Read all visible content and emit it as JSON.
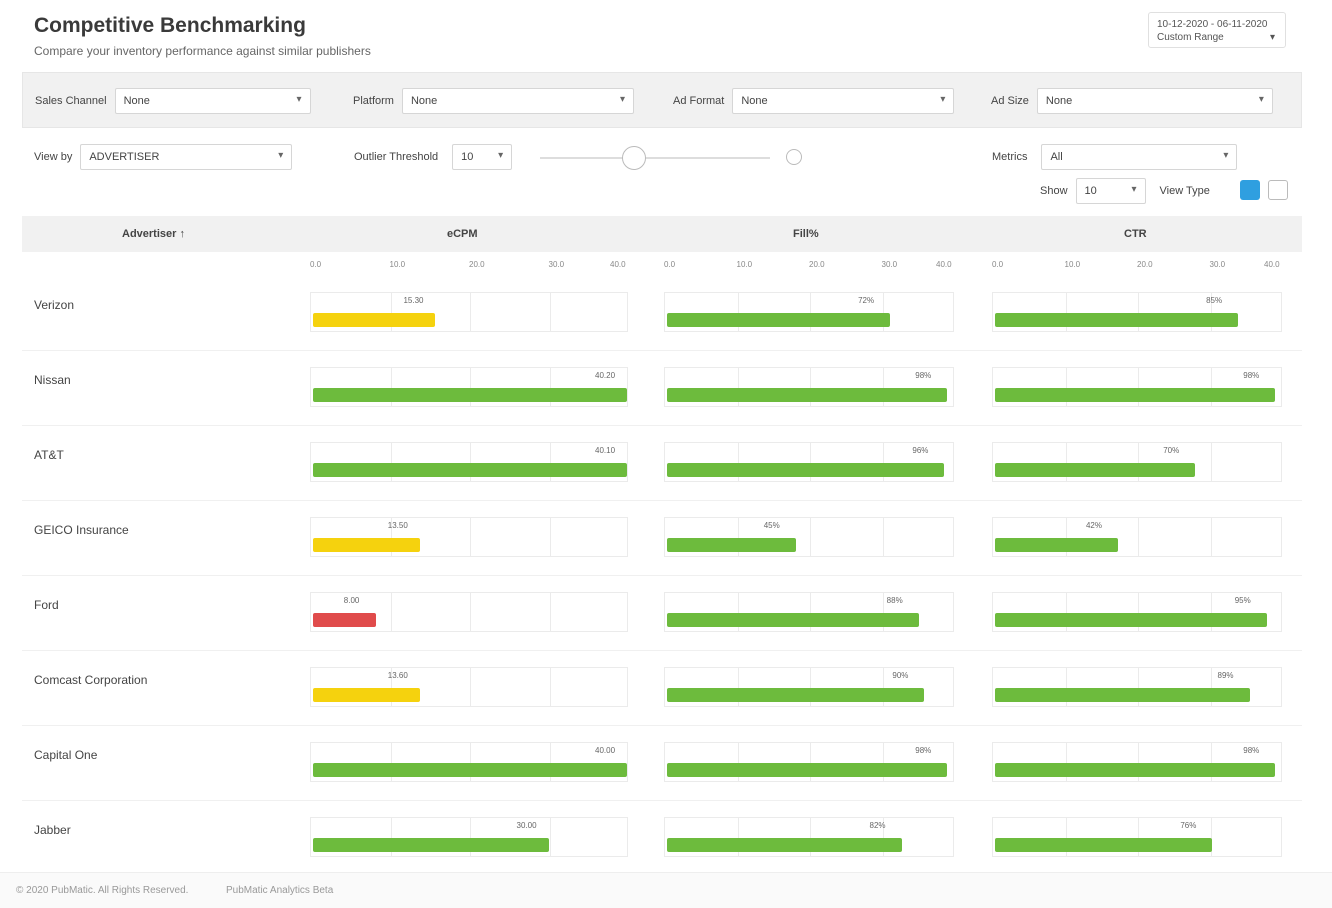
{
  "page": {
    "title": "Competitive Benchmarking",
    "subtitle": "Compare your inventory performance against similar publishers"
  },
  "date_range": {
    "line1": "10-12-2020 - 06-11-2020",
    "line2": "Custom Range",
    "icon": "calendar-icon"
  },
  "filters": [
    {
      "label": "Sales Channel",
      "value": "None"
    },
    {
      "label": "Platform",
      "value": "None"
    },
    {
      "label": "Ad Format",
      "value": "None"
    },
    {
      "label": "Ad Size",
      "value": "None"
    }
  ],
  "controls": {
    "view_by_label": "View by",
    "view_by_value": "ADVERTISER",
    "outlier_label": "Outlier Threshold",
    "outlier_value": "10",
    "metrics_label": "Metrics",
    "metrics_value": "All",
    "show_label": "Show",
    "show_value": "10",
    "view_type_label": "View Type",
    "view_type_active": "bar-view-icon",
    "view_type_inactive": "grid-view-icon"
  },
  "table": {
    "header_advertiser": "Advertiser ↑",
    "columns": [
      "eCPM",
      "Fill%",
      "CTR"
    ],
    "axis_ticks": [
      "0.0",
      "10.0",
      "20.0",
      "30.0",
      "40.0"
    ],
    "rows": [
      {
        "name": "Verizon",
        "values": [
          {
            "value": 15.3,
            "label": "15.30",
            "fraction": 0.39,
            "color": "#f5d20e"
          },
          {
            "value": 72,
            "label": "72%",
            "fraction": 0.78,
            "color": "#6dbb3d"
          },
          {
            "value": 85,
            "label": "85%",
            "fraction": 0.85,
            "color": "#6dbb3d"
          }
        ]
      },
      {
        "name": "Nissan",
        "values": [
          {
            "value": 40.2,
            "label": "40.20",
            "fraction": 1.0,
            "color": "#6dbb3d"
          },
          {
            "value": 98,
            "label": "98%",
            "fraction": 0.98,
            "color": "#6dbb3d"
          },
          {
            "value": 98,
            "label": "98%",
            "fraction": 0.98,
            "color": "#6dbb3d"
          }
        ]
      },
      {
        "name": "AT&T",
        "values": [
          {
            "value": 40.1,
            "label": "40.10",
            "fraction": 1.0,
            "color": "#6dbb3d"
          },
          {
            "value": 96,
            "label": "96%",
            "fraction": 0.97,
            "color": "#6dbb3d"
          },
          {
            "value": 70,
            "label": "70%",
            "fraction": 0.7,
            "color": "#6dbb3d"
          }
        ]
      },
      {
        "name": "GEICO Insurance",
        "values": [
          {
            "value": 13.5,
            "label": "13.50",
            "fraction": 0.34,
            "color": "#f5d20e"
          },
          {
            "value": 45,
            "label": "45%",
            "fraction": 0.45,
            "color": "#6dbb3d"
          },
          {
            "value": 42,
            "label": "42%",
            "fraction": 0.43,
            "color": "#6dbb3d"
          }
        ]
      },
      {
        "name": "Ford",
        "values": [
          {
            "value": 8.0,
            "label": "8.00",
            "fraction": 0.2,
            "color": "#e04b4b"
          },
          {
            "value": 88,
            "label": "88%",
            "fraction": 0.88,
            "color": "#6dbb3d"
          },
          {
            "value": 95,
            "label": "95%",
            "fraction": 0.95,
            "color": "#6dbb3d"
          }
        ]
      },
      {
        "name": "Comcast Corporation",
        "values": [
          {
            "value": 13.6,
            "label": "13.60",
            "fraction": 0.34,
            "color": "#f5d20e"
          },
          {
            "value": 90,
            "label": "90%",
            "fraction": 0.9,
            "color": "#6dbb3d"
          },
          {
            "value": 89,
            "label": "89%",
            "fraction": 0.89,
            "color": "#6dbb3d"
          }
        ]
      },
      {
        "name": "Capital One",
        "values": [
          {
            "value": 40.0,
            "label": "40.00",
            "fraction": 1.0,
            "color": "#6dbb3d"
          },
          {
            "value": 98,
            "label": "98%",
            "fraction": 0.98,
            "color": "#6dbb3d"
          },
          {
            "value": 98,
            "label": "98%",
            "fraction": 0.98,
            "color": "#6dbb3d"
          }
        ]
      },
      {
        "name": "Jabber",
        "values": [
          {
            "value": 30.0,
            "label": "30.00",
            "fraction": 0.75,
            "color": "#6dbb3d"
          },
          {
            "value": 82,
            "label": "82%",
            "fraction": 0.82,
            "color": "#6dbb3d"
          },
          {
            "value": 76,
            "label": "76%",
            "fraction": 0.76,
            "color": "#6dbb3d"
          }
        ]
      }
    ]
  },
  "footer": {
    "copyright": "© 2020 PubMatic. All Rights Reserved.",
    "link": "PubMatic Analytics Beta"
  }
}
